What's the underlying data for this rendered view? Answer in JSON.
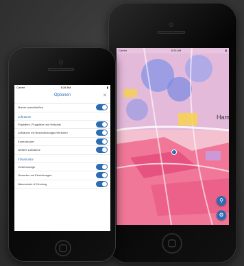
{
  "colors": {
    "accent": "#2b6cb3",
    "map_base": "#f4c6d2",
    "toggle_on": "#2b6cb3"
  },
  "map_phone": {
    "status": {
      "carrier": "Carrier",
      "time": "8:26 AM"
    },
    "labels": {
      "city": "Ham"
    },
    "buttons": {
      "search_icon": "search-icon",
      "settings_icon": "gear-icon"
    }
  },
  "options_phone": {
    "status": {
      "carrier": "Carrier",
      "time": "8:28 AM"
    },
    "title": "Optionen",
    "close_icon": "close-icon",
    "rows_top": [
      {
        "label": "Marker ausschließen",
        "on": true
      }
    ],
    "sections": [
      {
        "title": "Lufträume",
        "rows": [
          {
            "label": "Flughäfen, Flugplätze und Helipads",
            "on": true
          },
          {
            "label": "Lufträume mit Beschränkungen/Verboten",
            "on": true
          },
          {
            "label": "Kontrollzonen",
            "on": true
          },
          {
            "label": "Weitere Lufträume",
            "on": true
          }
        ]
      },
      {
        "title": "Infrastruktur",
        "rows": [
          {
            "label": "Verkehrswege",
            "on": true
          },
          {
            "label": "Gewerbe und Einrichtungen",
            "on": true
          },
          {
            "label": "Naturschutz & Erholung",
            "on": true
          }
        ]
      }
    ]
  }
}
